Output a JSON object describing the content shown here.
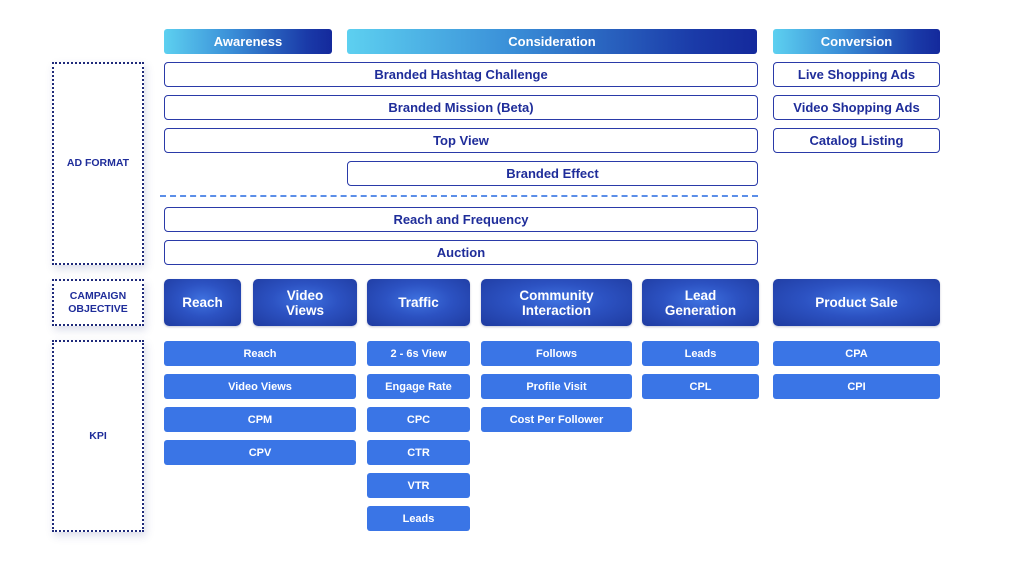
{
  "stages": {
    "awareness": "Awareness",
    "consideration": "Consideration",
    "conversion": "Conversion"
  },
  "row_labels": {
    "ad_format": "AD FORMAT",
    "campaign_objective": "CAMPAIGN OBJECTIVE",
    "kpi": "KPI"
  },
  "ad_formats": {
    "branded_hashtag_challenge": "Branded Hashtag Challenge",
    "branded_mission": "Branded Mission (Beta)",
    "top_view": "Top View",
    "branded_effect": "Branded Effect",
    "reach_and_frequency": "Reach and Frequency",
    "auction": "Auction",
    "live_shopping_ads": "Live Shopping Ads",
    "video_shopping_ads": "Video Shopping Ads",
    "catalog_listing": "Catalog Listing"
  },
  "objectives": {
    "reach": "Reach",
    "video_views": "Video Views",
    "traffic": "Traffic",
    "community_interaction": "Community Interaction",
    "lead_generation": "Lead Generation",
    "product_sale": "Product Sale"
  },
  "kpis": {
    "reach_col": [
      "Reach",
      "Video Views",
      "CPM",
      "CPV"
    ],
    "traffic_col": [
      "2 - 6s View",
      "Engage Rate",
      "CPC",
      "CTR",
      "VTR",
      "Leads"
    ],
    "community_col": [
      "Follows",
      "Profile Visit",
      "Cost Per Follower"
    ],
    "lead_col": [
      "Leads",
      "CPL"
    ],
    "product_col": [
      "CPA",
      "CPI"
    ]
  },
  "colors": {
    "stage_gradient_start": "#5dd0f0",
    "stage_gradient_end": "#14299c",
    "format_border": "#2a3aa8",
    "format_text": "#1f2d9a",
    "objective_fill": "#2c52c2",
    "kpi_fill": "#3a75e6",
    "divider": "#5b8ee8"
  }
}
